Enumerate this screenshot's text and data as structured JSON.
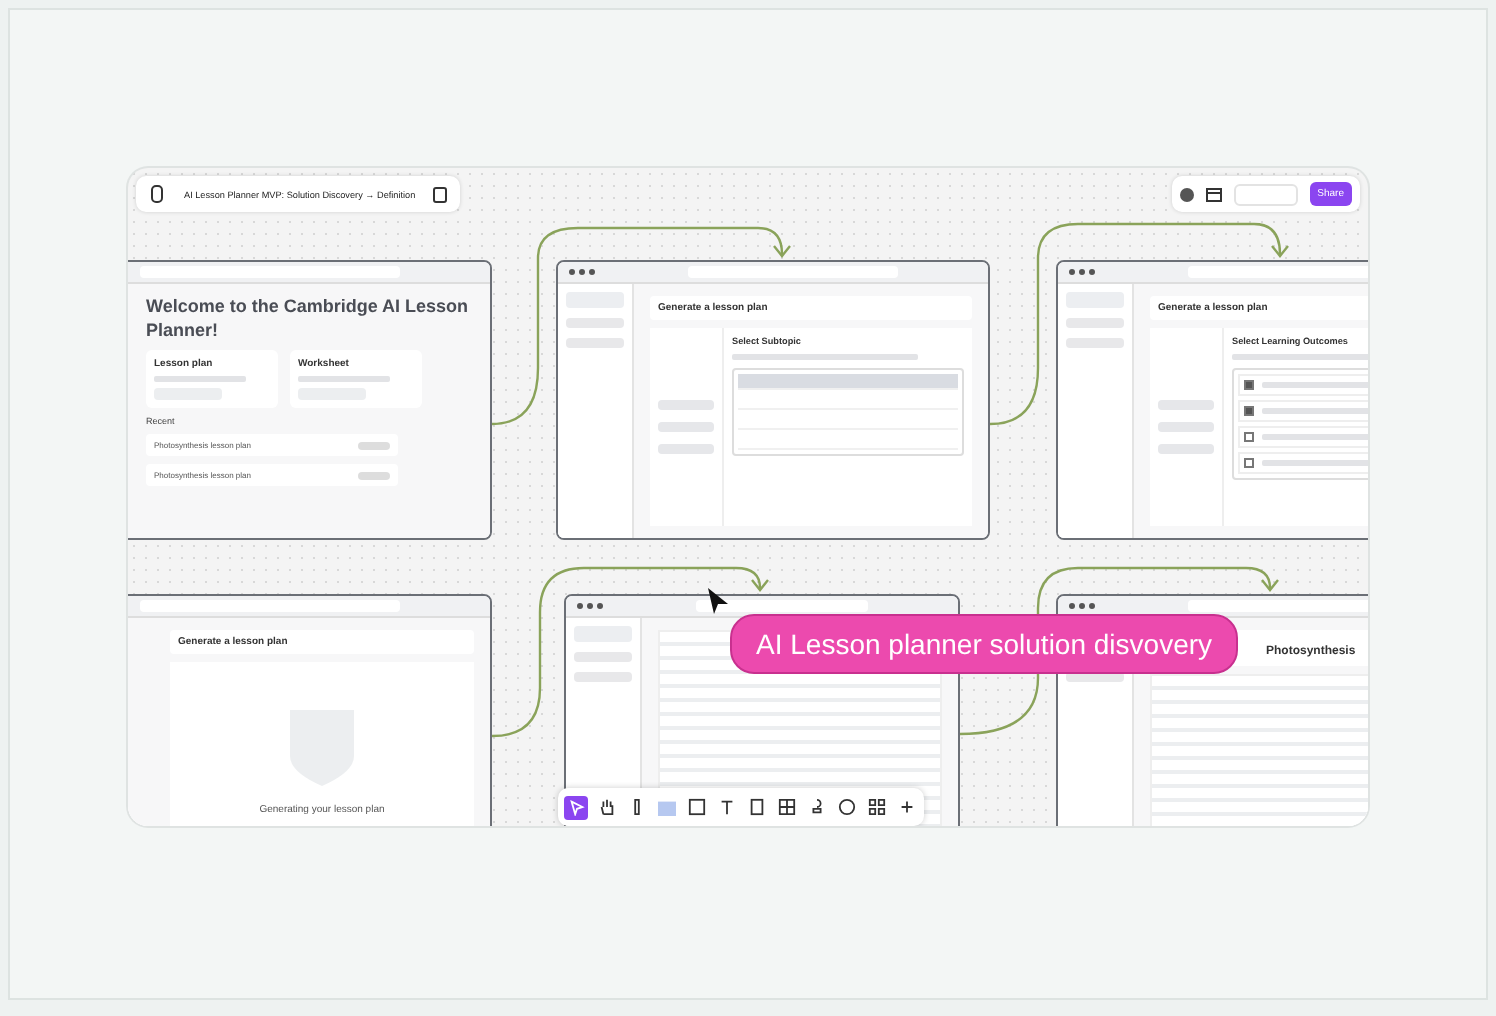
{
  "file_bar": {
    "title": "AI Lesson Planner MVP: Solution Discovery → Definition"
  },
  "share_button": {
    "label": "Share"
  },
  "frames": [
    {
      "kind": "home",
      "heading": "Welcome to the Cambridge AI Lesson Planner!",
      "cards": [
        "Lesson plan",
        "Worksheet"
      ],
      "section": "Recent",
      "items": [
        "Photosynthesis lesson plan",
        "Photosynthesis lesson plan"
      ]
    },
    {
      "kind": "subtopic",
      "back_title": "Generate a lesson plan",
      "heading": "Select Subtopic",
      "options": [
        {
          "selected": true
        },
        {
          "selected": false
        },
        {
          "selected": false
        },
        {
          "selected": false
        }
      ]
    },
    {
      "kind": "outcomes",
      "back_title": "Generate a lesson plan",
      "heading": "Select Learning Outcomes",
      "options": [
        {
          "checked": true
        },
        {
          "checked": true
        },
        {
          "checked": false
        },
        {
          "checked": false
        }
      ]
    },
    {
      "kind": "generating",
      "back_title": "Generate a lesson plan",
      "message": "Generating your lesson plan"
    },
    {
      "kind": "plan"
    },
    {
      "kind": "result",
      "heading": "Photosynthesis"
    }
  ],
  "section_label": {
    "text": "AI Lesson planner solution disvovery"
  },
  "tools": [
    {
      "kind": "select",
      "selected": true
    },
    {
      "kind": "hand",
      "selected": false
    },
    {
      "kind": "pen",
      "selected": false
    },
    {
      "kind": "sticky",
      "selected": false
    },
    {
      "kind": "rect",
      "selected": false
    },
    {
      "kind": "text",
      "selected": false
    },
    {
      "kind": "frame",
      "selected": false
    },
    {
      "kind": "table",
      "selected": false
    },
    {
      "kind": "stamp",
      "selected": false
    },
    {
      "kind": "comment",
      "selected": false
    },
    {
      "kind": "widget",
      "selected": false
    },
    {
      "kind": "plus",
      "selected": false
    }
  ]
}
